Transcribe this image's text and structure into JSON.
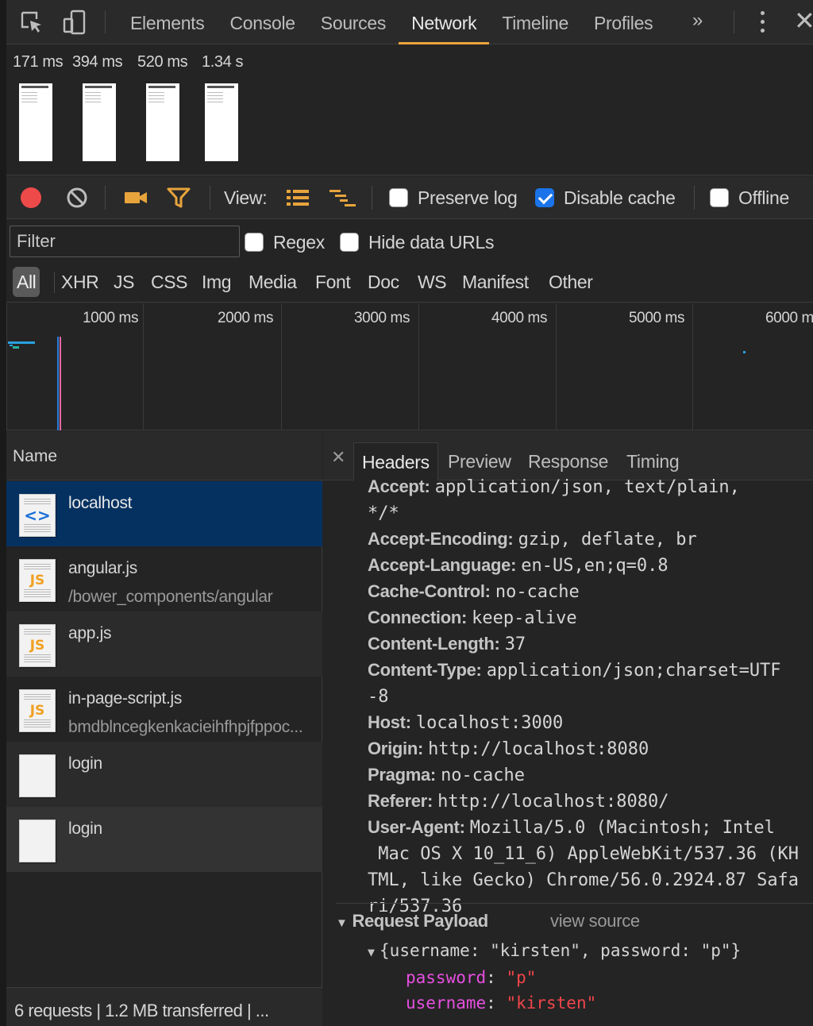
{
  "tabs": [
    "Elements",
    "Console",
    "Sources",
    "Network",
    "Timeline",
    "Profiles"
  ],
  "active_tab": "Network",
  "more_tabs_glyph": "»",
  "filmstrip": {
    "times": [
      "171 ms",
      "394 ms",
      "520 ms",
      "1.34 s"
    ]
  },
  "toolbar": {
    "view_label": "View:",
    "preserve_log": {
      "label": "Preserve log",
      "checked": false
    },
    "disable_cache": {
      "label": "Disable cache",
      "checked": true
    },
    "offline": {
      "label": "Offline",
      "checked": false
    }
  },
  "filter": {
    "placeholder": "Filter",
    "regex_label": "Regex",
    "hide_data_urls_label": "Hide data URLs"
  },
  "types": [
    "All",
    "XHR",
    "JS",
    "CSS",
    "Img",
    "Media",
    "Font",
    "Doc",
    "WS",
    "Manifest",
    "Other"
  ],
  "overview": {
    "ticks": [
      "1000 ms",
      "2000 ms",
      "3000 ms",
      "4000 ms",
      "5000 ms",
      "6000 ms"
    ]
  },
  "requests": {
    "header": "Name",
    "rows": [
      {
        "name": "localhost",
        "path": "",
        "icon": "html-file-icon"
      },
      {
        "name": "angular.js",
        "path": "/bower_components/angular",
        "icon": "js-file-icon"
      },
      {
        "name": "app.js",
        "path": "",
        "icon": "js-file-icon"
      },
      {
        "name": "in-page-script.js",
        "path": "bmdblncegkenkacieihfhpjfppoc...",
        "icon": "js-file-icon"
      },
      {
        "name": "login",
        "path": "",
        "icon": "blank-file-icon"
      },
      {
        "name": "login",
        "path": "",
        "icon": "blank-file-icon"
      }
    ],
    "status": "6 requests | 1.2 MB transferred | ..."
  },
  "details": {
    "tabs": [
      "Headers",
      "Preview",
      "Response",
      "Timing"
    ],
    "active_tab": "Headers",
    "headers": [
      {
        "key": "Accept:",
        "lines": [
          "application/json, text/plain,",
          "*/*"
        ]
      },
      {
        "key": "Accept-Encoding:",
        "lines": [
          "gzip, deflate, br"
        ]
      },
      {
        "key": "Accept-Language:",
        "lines": [
          "en-US,en;q=0.8"
        ]
      },
      {
        "key": "Cache-Control:",
        "lines": [
          "no-cache"
        ]
      },
      {
        "key": "Connection:",
        "lines": [
          "keep-alive"
        ]
      },
      {
        "key": "Content-Length:",
        "lines": [
          "37"
        ]
      },
      {
        "key": "Content-Type:",
        "lines": [
          "application/json;charset=UTF",
          "-8"
        ]
      },
      {
        "key": "Host:",
        "lines": [
          "localhost:3000"
        ]
      },
      {
        "key": "Origin:",
        "lines": [
          "http://localhost:8080"
        ]
      },
      {
        "key": "Pragma:",
        "lines": [
          "no-cache"
        ]
      },
      {
        "key": "Referer:",
        "lines": [
          "http://localhost:8080/"
        ]
      },
      {
        "key": "User-Agent:",
        "lines": [
          "Mozilla/5.0 (Macintosh; Intel",
          " Mac OS X 10_11_6) AppleWebKit/537.36 (KH",
          "TML, like Gecko) Chrome/56.0.2924.87 Safa",
          "ri/537.36"
        ]
      }
    ],
    "payload": {
      "title": "Request Payload",
      "view_source": "view source",
      "object": "{username: \"kirsten\", password: \"p\"}",
      "props": [
        {
          "key": "password",
          "value": "\"p\""
        },
        {
          "key": "username",
          "value": "\"kirsten\""
        }
      ]
    }
  },
  "colors": {
    "record": "#ef4a4a",
    "accent": "#e8a43c",
    "selected_row": "#053161",
    "checkbox_checked": "#1a73e8"
  }
}
